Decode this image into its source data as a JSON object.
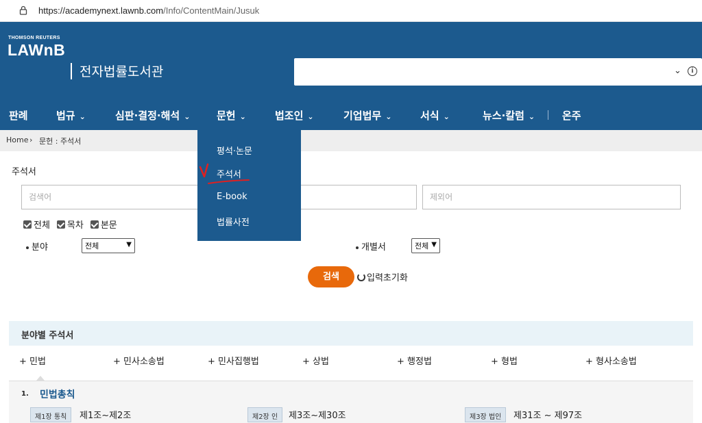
{
  "browser": {
    "url_host": "https://academynext.lawnb.com",
    "url_path": "/Info/ContentMain/Jusuk"
  },
  "header": {
    "brand_small": "THOMSON REUTERS",
    "brand": "LAWnB",
    "subtitle": "전자법률도서관"
  },
  "nav": {
    "items": [
      {
        "label": "판례",
        "caret": false
      },
      {
        "label": "법규",
        "caret": true
      },
      {
        "label": "심판·결정·해석",
        "caret": true
      },
      {
        "label": "문헌",
        "caret": true
      },
      {
        "label": "법조인",
        "caret": true
      },
      {
        "label": "기업법무",
        "caret": true
      },
      {
        "label": "서식",
        "caret": true
      },
      {
        "label": "뉴스·칼럼",
        "caret": true
      },
      {
        "label": "온주",
        "caret": false
      }
    ]
  },
  "breadcrumb": {
    "home": "Home",
    "path": "문헌 : 주석서"
  },
  "dropdown": {
    "items": [
      "평석·논문",
      "주석서",
      "E-book",
      "법률사전"
    ],
    "selected": "주석서"
  },
  "form": {
    "title": "주석서",
    "search_placeholder": "검색어",
    "exclude_placeholder": "제외어",
    "checks": [
      "전체",
      "목차",
      "본문"
    ],
    "field_label": "분야",
    "field_value": "전체",
    "individual_label": "개별서",
    "individual_value": "전체",
    "search_button": "검색",
    "reset_label": "입력초기화"
  },
  "category": {
    "title": "분야별 주석서",
    "tabs": [
      "+ 민법",
      "+ 민사소송법",
      "+ 민사집행법",
      "+ 상법",
      "+ 행정법",
      "+ 형법",
      "+ 형사소송법"
    ],
    "section_number": "1.",
    "section_title": "민법총칙",
    "chapters": [
      {
        "tag": "제1장 통칙",
        "range": "제1조~제2조"
      },
      {
        "tag": "제2장 인",
        "range": "제3조~제30조"
      },
      {
        "tag": "제3장 법인",
        "range": "제31조 ~ 제97조"
      }
    ]
  },
  "colors": {
    "header_bg": "#1c5a8e",
    "button": "#e8690b",
    "check_mark": "#e02020"
  }
}
